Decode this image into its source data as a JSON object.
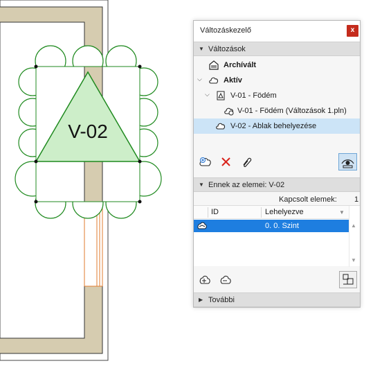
{
  "drawing": {
    "marker_label": "V-02"
  },
  "panel": {
    "title": "Változáskezelő",
    "close_label": "x",
    "changes_section": {
      "label": "Változások",
      "items": [
        {
          "label": "Archívált"
        },
        {
          "label": "Aktív"
        },
        {
          "label": "V-01 - Födém"
        },
        {
          "label": "V-01 - Födém (Változások 1.pln)"
        },
        {
          "label": "V-02 - Ablak behelyezése"
        }
      ]
    },
    "elements_section": {
      "label": "Ennek az elemei: V-02",
      "linked_label": "Kapcsolt elemek:",
      "linked_count": "1",
      "columns": {
        "id": "ID",
        "location": "Lehelyezve"
      },
      "rows": [
        {
          "id": "",
          "location": "0. 0. Szint"
        }
      ]
    },
    "more_section": {
      "label": "További"
    }
  },
  "colors": {
    "wall_fill": "#d6ccb0",
    "marker_stroke": "#1f8a1f",
    "marker_fill": "#cdeec9",
    "selected_row": "#cce4f7",
    "grid_selected": "#1e7ee0",
    "close_button": "#c42b1c",
    "delete_red": "#d9241c"
  }
}
